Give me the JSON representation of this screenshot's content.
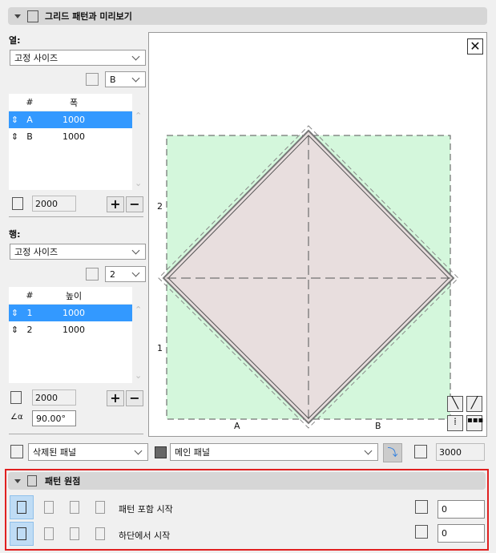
{
  "section1": {
    "title": "그리드 패턴과 미리보기"
  },
  "columns": {
    "label": "열:",
    "mode": "고정 사이즈",
    "count_select": "B",
    "headers": [
      "#",
      "폭"
    ],
    "rows": [
      {
        "id": "A",
        "value": "1000",
        "selected": true
      },
      {
        "id": "B",
        "value": "1000",
        "selected": false
      }
    ],
    "total": "2000"
  },
  "rows_section": {
    "label": "행:",
    "mode": "고정 사이즈",
    "count_select": "2",
    "headers": [
      "#",
      "높이"
    ],
    "rows": [
      {
        "id": "1",
        "value": "1000",
        "selected": true
      },
      {
        "id": "2",
        "value": "1000",
        "selected": false
      }
    ],
    "total": "2000",
    "angle": "90.00°"
  },
  "preview": {
    "row_labels": [
      "2",
      "1"
    ],
    "col_labels": [
      "A",
      "B"
    ],
    "colors": {
      "fill_green": "#d4f7dc",
      "diamond": "#e8dede"
    }
  },
  "panels": {
    "deleted": "삭제된 패널",
    "main": "메인 패널",
    "height": "3000"
  },
  "section2": {
    "title": "패턴 원점",
    "h_label": "패턴 포함 시작",
    "v_label": "하단에서 시작",
    "h_offset": "0",
    "v_offset": "0"
  },
  "accent": "#3399ff",
  "highlight_border": "#e02020"
}
